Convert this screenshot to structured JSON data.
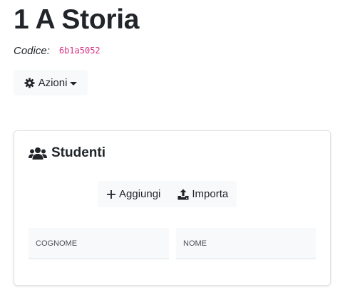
{
  "page": {
    "title": "1 A Storia",
    "code_label": "Codice:",
    "code_value": "6b1a5052"
  },
  "actions": {
    "label": "Azioni",
    "icon": "gear-icon"
  },
  "students_card": {
    "title": "Studenti",
    "icon": "users-icon",
    "buttons": {
      "add_label": "Aggiungi",
      "add_icon": "plus-icon",
      "import_label": "Importa",
      "import_icon": "upload-icon"
    },
    "table": {
      "columns": [
        "COGNOME",
        "NOME"
      ],
      "rows": []
    }
  },
  "colors": {
    "text": "#212529",
    "code": "#d63384",
    "button_bg": "#f8f9fa",
    "border": "#dee2e6"
  }
}
